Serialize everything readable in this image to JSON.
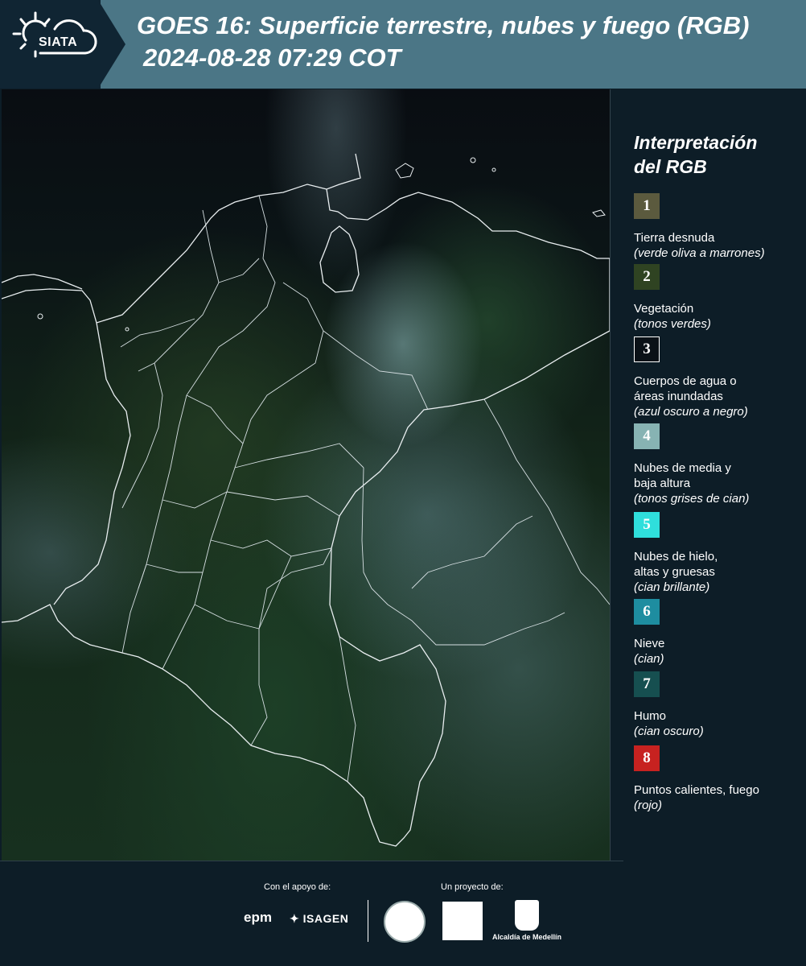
{
  "header": {
    "logo_text": "SIATA",
    "title_line1": "GOES 16: Superficie terrestre, nubes y fuego (RGB)",
    "title_line2": "2024-08-28 07:29 COT"
  },
  "legend": {
    "title_line1": "Interpretación",
    "title_line2": "del RGB",
    "items": [
      {
        "number": "1",
        "color": "#5b5a3e",
        "label_lines": [
          "Tierra desnuda"
        ],
        "desc": "(verde oliva a marrones)"
      },
      {
        "number": "2",
        "color": "#2f4322",
        "label_lines": [
          "Vegetación"
        ],
        "desc": "(tonos verdes)"
      },
      {
        "number": "3",
        "color": "#0a1117",
        "label_lines": [
          "Cuerpos de agua o",
          "áreas inundadas"
        ],
        "desc": "(azul oscuro a negro)"
      },
      {
        "number": "4",
        "color": "#87b3b3",
        "label_lines": [
          "Nubes de media y",
          "baja altura"
        ],
        "desc": "(tonos grises de cian)"
      },
      {
        "number": "5",
        "color": "#2fdfdc",
        "label_lines": [
          "Nubes de hielo,",
          "altas y gruesas"
        ],
        "desc": "(cian brillante)"
      },
      {
        "number": "6",
        "color": "#1e8da0",
        "label_lines": [
          "Nieve"
        ],
        "desc": "(cian)"
      },
      {
        "number": "7",
        "color": "#164f50",
        "label_lines": [
          "Humo"
        ],
        "desc": "(cian oscuro)"
      },
      {
        "number": "8",
        "color": "#c72220",
        "label_lines": [
          "Puntos calientes, fuego"
        ],
        "desc": "(rojo)"
      }
    ]
  },
  "footer": {
    "support_label": "Con el apoyo de:",
    "project_label": "Un proyecto de:",
    "epm_logo": "epm",
    "isagen_logo": "ISAGEN",
    "alcaldia_label": "Alcaldía de Medellín"
  }
}
